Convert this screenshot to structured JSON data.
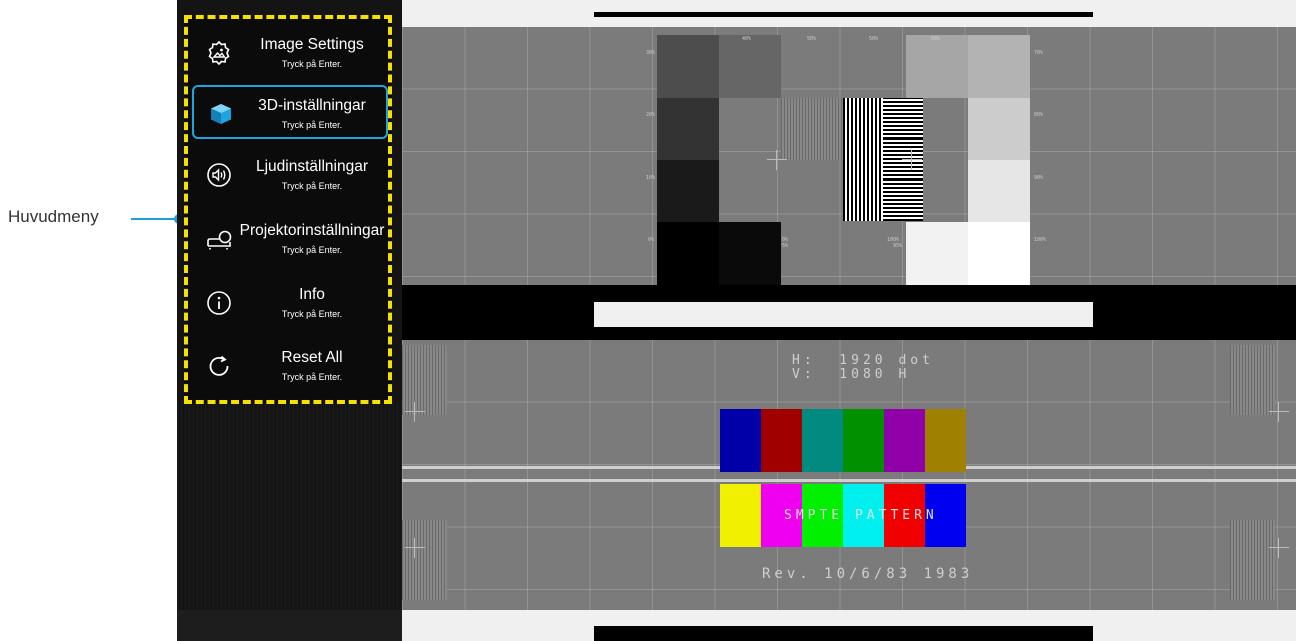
{
  "callout": {
    "label": "Huvudmeny",
    "color": "#1aa0dc"
  },
  "menu": {
    "border_color": "#f5e100",
    "selected_color": "#1ea5e0",
    "items": [
      {
        "title": "Image Settings",
        "hint": "Tryck på Enter.",
        "icon": "image-settings-icon"
      },
      {
        "title": "3D-inställningar",
        "hint": "Tryck på Enter.",
        "icon": "cube-3d-icon",
        "selected": true
      },
      {
        "title": "Ljudinställningar",
        "hint": "Tryck på Enter.",
        "icon": "speaker-icon"
      },
      {
        "title": "Projektorinställningar",
        "hint": "Tryck på Enter.",
        "icon": "projector-icon"
      },
      {
        "title": "Info",
        "hint": "Tryck på Enter.",
        "icon": "info-icon"
      },
      {
        "title": "Reset All",
        "hint": "Tryck på Enter.",
        "icon": "reset-icon"
      }
    ]
  },
  "test_pattern": {
    "resolution_h": "H:  1920 dot",
    "resolution_v": "V:  1080 H",
    "name": "SMPTE PATTERN",
    "revision": "Rev. 10/6/83 1983",
    "gray_labels": {
      "p0": "0%",
      "p5": "5%",
      "p10": "10%",
      "p20": "20%",
      "p30": "30%",
      "p40": "40%",
      "p50": "50%",
      "p50b": "50%",
      "p60": "60%",
      "p70": "70%",
      "p80": "80%",
      "p90": "90%",
      "p95": "95%",
      "p100": "100%",
      "p100b": "100%"
    },
    "top_colors": [
      "#0000a8",
      "#a00000",
      "#008a80",
      "#009000",
      "#9000a8",
      "#a08000"
    ],
    "bottom_colors": [
      "#f0f000",
      "#f000f0",
      "#00f000",
      "#00f0f0",
      "#f00000",
      "#0000f0"
    ]
  }
}
